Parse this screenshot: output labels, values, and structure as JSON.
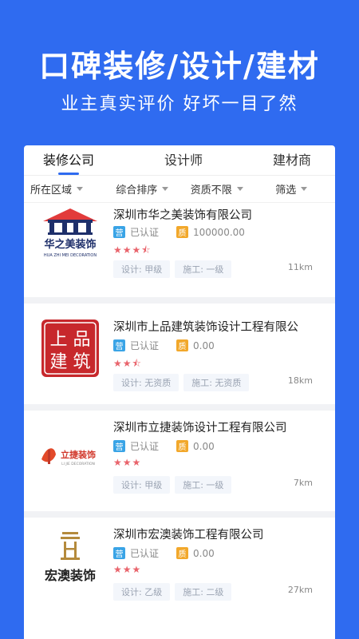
{
  "hero": {
    "title": "口碑装修/设计/建材",
    "subtitle": "业主真实评价 好坏一目了然"
  },
  "tabs": [
    {
      "label": "装修公司",
      "active": true
    },
    {
      "label": "设计师",
      "active": false
    },
    {
      "label": "建材商",
      "active": false
    }
  ],
  "filters": [
    {
      "label": "所在区域"
    },
    {
      "label": "综合排序"
    },
    {
      "label": "资质不限"
    },
    {
      "label": "筛选"
    }
  ],
  "companies": [
    {
      "name": "深圳市华之美装饰有限公司",
      "logo_text": "华之美装饰",
      "logo_sub": "HUA ZHI MEI DECORATION",
      "certified": "已认证",
      "ying": "营",
      "zhi": "质",
      "capital": "100000.00",
      "rating": 3.5,
      "stars": "★★★⯪",
      "design": "设计: 甲级",
      "build": "施工: 一级",
      "distance": "11km"
    },
    {
      "name": "深圳市上品建筑装饰设计工程有限公",
      "logo_text": "上品建筑",
      "certified": "已认证",
      "ying": "营",
      "zhi": "质",
      "capital": "0.00",
      "rating": 2.5,
      "stars": "★★⯪",
      "design": "设计: 无资质",
      "build": "施工: 无资质",
      "distance": "18km"
    },
    {
      "name": "深圳市立捷装饰设计工程有限公司",
      "logo_text": "立捷装饰",
      "logo_sub": "LI JIE DECORATION",
      "certified": "已认证",
      "ying": "营",
      "zhi": "质",
      "capital": "0.00",
      "rating": 3,
      "stars": "★★★",
      "design": "设计: 甲级",
      "build": "施工: 一级",
      "distance": "7km"
    },
    {
      "name": "深圳市宏澳装饰工程有限公司",
      "logo_text": "宏澳装饰",
      "certified": "已认证",
      "ying": "营",
      "zhi": "质",
      "capital": "0.00",
      "rating": 3,
      "stars": "★★★",
      "design": "设计: 乙级",
      "build": "施工: 二级",
      "distance": "27km"
    }
  ],
  "colors": {
    "brand": "#2f6bf0",
    "star": "#e9646c",
    "ying_badge": "#3aa4e6",
    "zhi_badge": "#f2a82b"
  }
}
